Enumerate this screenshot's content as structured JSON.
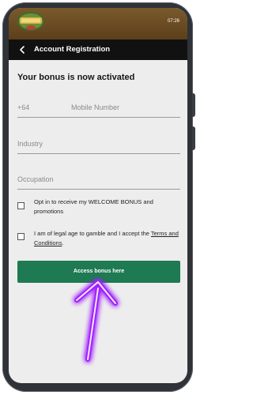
{
  "status_bar": {
    "time": "07:26",
    "logo_icon": "casino-logo-icon"
  },
  "header": {
    "back_icon": "chevron-left-icon",
    "title": "Account Registration"
  },
  "form": {
    "heading": "Your bonus is now activated",
    "phone": {
      "prefix": "+64",
      "placeholder": "Mobile Number"
    },
    "industry": {
      "placeholder": "Industry"
    },
    "occupation": {
      "placeholder": "Occupation"
    },
    "opt_in": {
      "checked": false,
      "text": "Opt in to receive my WELCOME BONUS and promotions"
    },
    "legal": {
      "checked": false,
      "text_before": "I am of legal age to gamble and I accept the ",
      "link_text": "Terms and Conditions",
      "text_after": "."
    },
    "submit_label": "Access bonus here"
  },
  "colors": {
    "accent": "#1e7a52",
    "header": "#111111",
    "arrow_glow": "#a020ff"
  }
}
